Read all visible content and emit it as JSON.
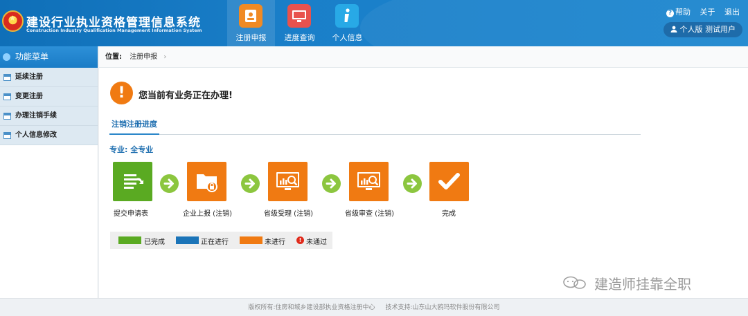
{
  "header": {
    "title": "建设行业执业资格管理信息系统",
    "subtitle": "Construction Industry Qualification Management Information System",
    "nav": [
      {
        "label": "注册申报",
        "icon": "contact-card-icon",
        "active": true
      },
      {
        "label": "进度查询",
        "icon": "monitor-icon",
        "active": false
      },
      {
        "label": "个人信息",
        "icon": "info-icon",
        "active": false
      }
    ],
    "links": {
      "help": "帮助",
      "about": "关于",
      "logout": "退出"
    },
    "user": {
      "type": "个人版",
      "name": "测试用户"
    }
  },
  "sidebar": {
    "title": "功能菜单",
    "items": [
      {
        "label": "延续注册"
      },
      {
        "label": "变更注册"
      },
      {
        "label": "办理注销手续"
      },
      {
        "label": "个人信息修改"
      }
    ]
  },
  "breadcrumb": {
    "label": "位置:",
    "current": "注册申报"
  },
  "alert": {
    "text": "您当前有业务正在办理!"
  },
  "tab": {
    "label": "注销注册进度"
  },
  "major": {
    "text": "专业: 全专业"
  },
  "steps": [
    {
      "label": "提交申请表",
      "status": "done",
      "icon": "document-submit-icon"
    },
    {
      "label": "企业上报 (注销)",
      "status": "pending",
      "icon": "folder-lock-icon"
    },
    {
      "label": "省级受理 (注销)",
      "status": "pending",
      "icon": "monitor-chart-icon"
    },
    {
      "label": "省级审查 (注销)",
      "status": "pending",
      "icon": "monitor-chart-icon"
    },
    {
      "label": "完成",
      "status": "pending",
      "icon": "checkmark-icon"
    }
  ],
  "legend": [
    {
      "label": "已完成",
      "color": "#5aaa22"
    },
    {
      "label": "正在进行",
      "color": "#1b74b8"
    },
    {
      "label": "未进行",
      "color": "#f07a12"
    },
    {
      "label": "未通过",
      "color": "#e02a1b"
    }
  ],
  "colors": {
    "done": "#5aaa22",
    "in_progress": "#1b74b8",
    "pending": "#f07a12",
    "failed": "#e02a1b",
    "header": "#1a7fc9"
  },
  "watermark": {
    "text": "建造师挂靠全职"
  },
  "footer": {
    "copyright": "版权所有:住房和城乡建设部执业资格注册中心",
    "support": "技术支持:山东山大鸥玛软件股份有限公司"
  }
}
